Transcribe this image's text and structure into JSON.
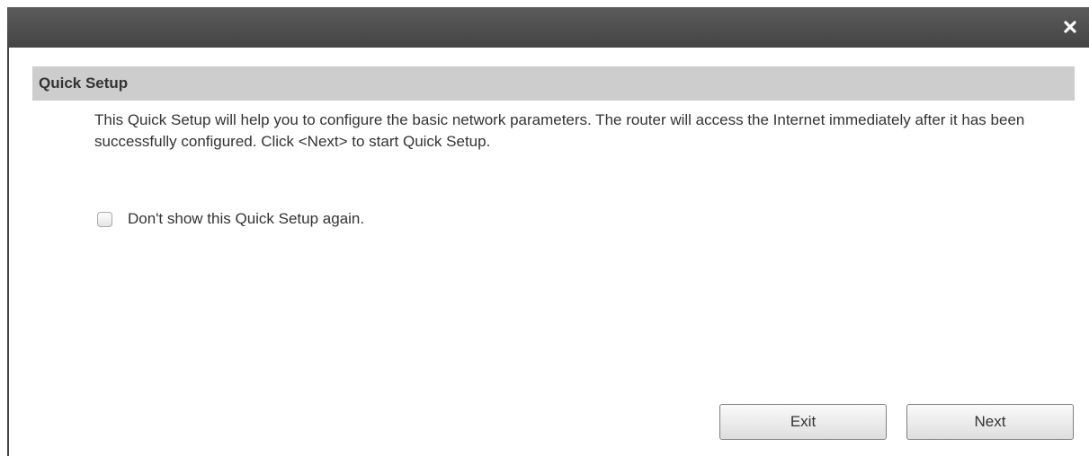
{
  "dialog": {
    "close_glyph": "✕"
  },
  "section": {
    "title": "Quick Setup",
    "description": "This Quick Setup will help you to configure the basic network parameters. The router will access the Internet immediately after it has been successfully configured. Click <Next> to start Quick Setup."
  },
  "options": {
    "dont_show_label": "Don't show this Quick Setup again.",
    "dont_show_checked": false
  },
  "buttons": {
    "exit_label": "Exit",
    "next_label": "Next"
  },
  "colors": {
    "titlebar": "#4d4d4d",
    "section_header": "#cdcdcd",
    "text": "#333333"
  },
  "icons": {
    "close": "close-icon"
  }
}
